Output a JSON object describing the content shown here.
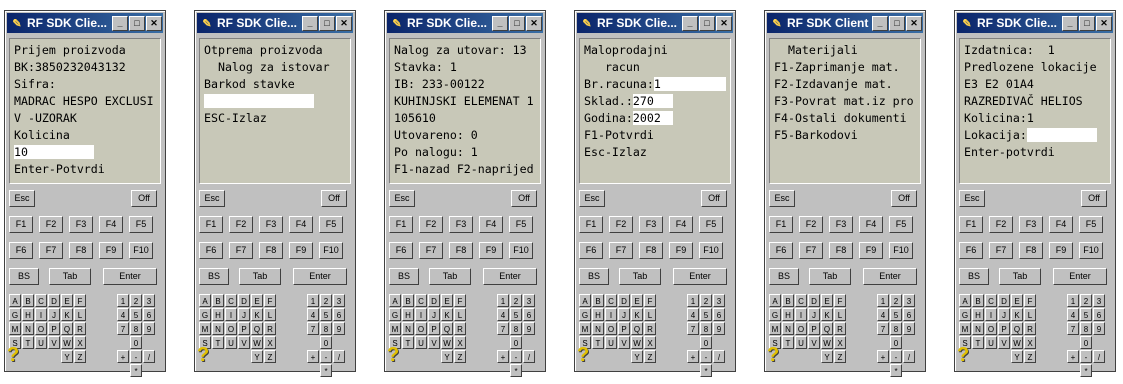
{
  "windows": [
    {
      "title": "RF SDK Clie...",
      "lines": [
        {
          "t": "Prijem proizvoda"
        },
        {
          "t": "BK:3850232043132"
        },
        {
          "t": "Sifra:"
        },
        {
          "t": "MADRAC HESPO EXCLUSI"
        },
        {
          "t": "V -UZORAK"
        },
        {
          "t": "Kolicina"
        },
        {
          "t": "",
          "f": "10",
          "fw": 80
        },
        {
          "t": "Enter-Potvrdi"
        }
      ]
    },
    {
      "title": "RF SDK Clie...",
      "lines": [
        {
          "t": "Otprema proizvoda"
        },
        {
          "t": "  Nalog za istovar"
        },
        {
          "t": ""
        },
        {
          "t": ""
        },
        {
          "t": "Barkod stavke"
        },
        {
          "t": "",
          "f": "",
          "fw": 110
        },
        {
          "t": ""
        },
        {
          "t": ""
        },
        {
          "t": "ESC-Izlaz"
        }
      ]
    },
    {
      "title": "RF SDK Clie...",
      "lines": [
        {
          "t": "Nalog za utovar: 13"
        },
        {
          "t": "Stavka: 1"
        },
        {
          "t": "IB: 233-00122"
        },
        {
          "t": "KUHINJSKI ELEMENAT 1"
        },
        {
          "t": "105610"
        },
        {
          "t": "Utovareno: 0"
        },
        {
          "t": "Po nalogu: 1"
        },
        {
          "t": "F1-nazad F2-naprijed"
        }
      ]
    },
    {
      "title": "RF SDK Clie...",
      "lines": [
        {
          "t": "Maloprodajni"
        },
        {
          "t": "   racun"
        },
        {
          "t": "Br.racuna:",
          "f": "1",
          "fw": 78
        },
        {
          "t": "Sklad.:",
          "f": "270",
          "fw": 40
        },
        {
          "t": "Godina:",
          "f": "2002",
          "fw": 40
        },
        {
          "t": "F1-Potvrdi"
        },
        {
          "t": "Esc-Izlaz"
        }
      ]
    },
    {
      "title": "RF SDK Client",
      "lines": [
        {
          "t": "  Materijali"
        },
        {
          "t": ""
        },
        {
          "t": "F1-Zaprimanje mat."
        },
        {
          "t": "F2-Izdavanje mat."
        },
        {
          "t": "F3-Povrat mat.iz pro"
        },
        {
          "t": "F4-Ostali dokumenti"
        },
        {
          "t": ""
        },
        {
          "t": "F5-Barkodovi"
        }
      ]
    },
    {
      "title": "RF SDK Clie...",
      "lines": [
        {
          "t": "Izdatnica:  1"
        },
        {
          "t": "Predlozene lokacije"
        },
        {
          "t": "E3 E2 01A4"
        },
        {
          "t": "RAZREDIVAČ HELIOS"
        },
        {
          "t": ""
        },
        {
          "t": "Kolicina:1"
        },
        {
          "t": "Lokacija:",
          "f": "",
          "fw": 70
        },
        {
          "t": "Enter-potvrdi"
        }
      ]
    }
  ],
  "keys": {
    "esc": "Esc",
    "off": "Off",
    "f1": "F1",
    "f2": "F2",
    "f3": "F3",
    "f4": "F4",
    "f5": "F5",
    "f6": "F6",
    "f7": "F7",
    "f8": "F8",
    "f9": "F9",
    "f10": "F10",
    "bs": "BS",
    "tab": "Tab",
    "enter": "Enter",
    "letters": [
      "A",
      "B",
      "C",
      "D",
      "E",
      "F",
      "G",
      "H",
      "I",
      "J",
      "K",
      "L",
      "M",
      "N",
      "O",
      "P",
      "Q",
      "R",
      "S",
      "T",
      "U",
      "V",
      "W",
      "X",
      "",
      "",
      "",
      "",
      "Y",
      "Z"
    ],
    "digits": [
      "1",
      "2",
      "3",
      "4",
      "5",
      "6",
      "7",
      "8",
      "9",
      "",
      "0",
      "",
      "+",
      "-",
      "/",
      "",
      "*",
      ""
    ],
    "help": "?"
  }
}
